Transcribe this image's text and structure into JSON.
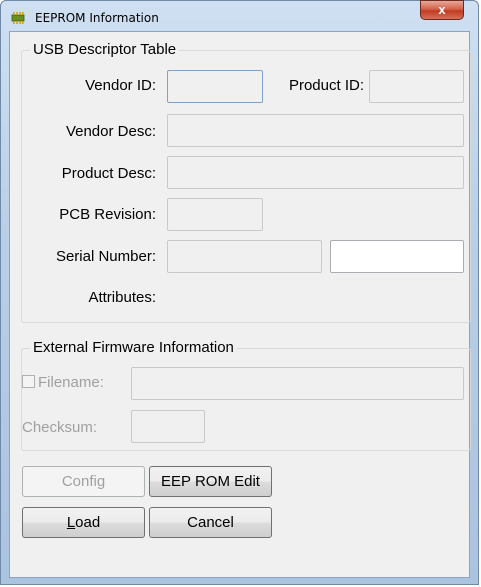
{
  "window": {
    "title": "EEPROM Information",
    "close_glyph": "x"
  },
  "usb": {
    "group_title": "USB Descriptor Table",
    "vendor_id_label": "Vendor ID:",
    "product_id_label": "Product ID:",
    "vendor_desc_label": "Vendor Desc:",
    "product_desc_label": "Product Desc:",
    "pcb_revision_label": "PCB Revision:",
    "serial_number_label": "Serial Number:",
    "attributes_label": "Attributes:",
    "vendor_id": "",
    "product_id": "",
    "vendor_desc": "",
    "product_desc": "",
    "pcb_revision": "",
    "serial_number": "",
    "serial_number_extra": ""
  },
  "firmware": {
    "group_title": "External Firmware Information",
    "filename_label": "Filename:",
    "checksum_label": "Checksum:",
    "filename": "",
    "checksum": "",
    "filename_checked": false
  },
  "buttons": {
    "config": "Config",
    "eeprom_edit": "EEP ROM Edit",
    "load_mnemonic": "L",
    "load_rest": "oad",
    "cancel": "Cancel"
  },
  "colors": {
    "title_bar": "#b9cfe7",
    "close_button": "#c23b21",
    "client_bg": "#f0f0f0"
  },
  "icons": {
    "app": "eeprom-chip-icon",
    "close": "close-icon"
  }
}
